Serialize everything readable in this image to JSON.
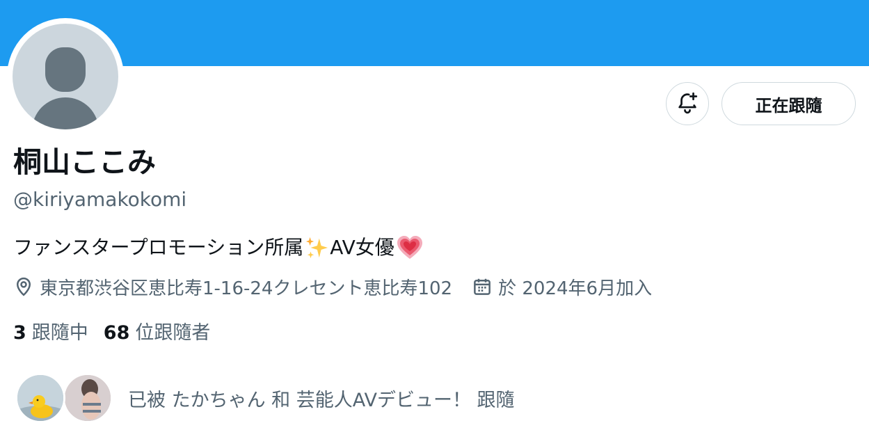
{
  "profile": {
    "display_name": "桐山ここみ",
    "handle": "@kiriyamakokomi",
    "bio_text": "ファンスタープロモーション所属",
    "bio_suffix": "AV女優",
    "bio_emoji_1": "sparkles-emoji",
    "bio_emoji_2": "growing-heart-emoji",
    "location": "東京都渋谷区恵比寿1-16-24クレセント恵比寿102",
    "joined": "於 2024年6月加入"
  },
  "actions": {
    "notify_icon": "bell-plus-icon",
    "follow_label": "正在跟隨"
  },
  "stats": {
    "following_count": "3",
    "following_label": "跟隨中",
    "followers_count": "68",
    "followers_label": "位跟隨者"
  },
  "followers_you_know": {
    "text": "已被 たかちゃん 和 芸能人AVデビュー！ 跟隨"
  },
  "colors": {
    "banner": "#1d9bf0",
    "secondary_text": "#536471",
    "primary_text": "#0f1419",
    "border": "#cfd9de",
    "avatar_bg": "#ccd6dd",
    "avatar_fg": "#66757f"
  }
}
